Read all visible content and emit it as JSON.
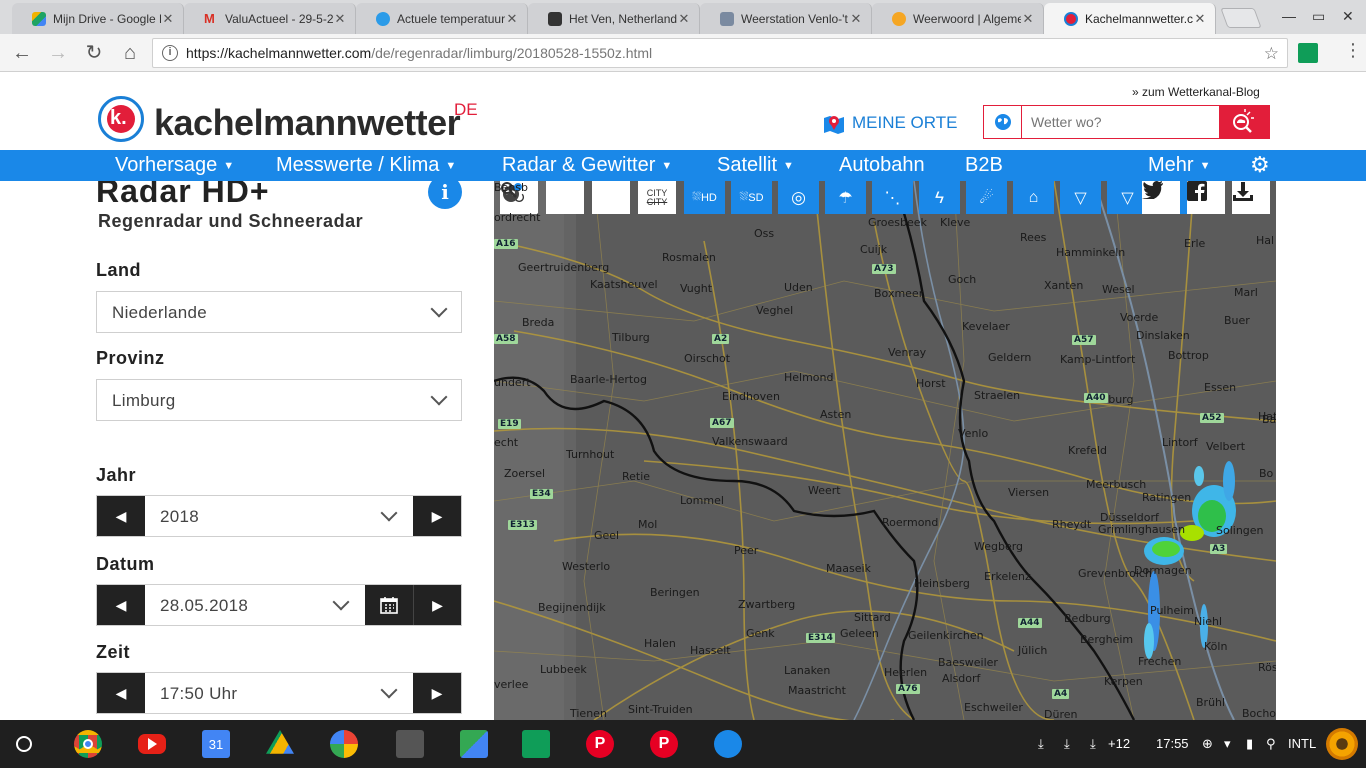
{
  "browser": {
    "tabs": [
      {
        "title": "Mijn Drive - Google D",
        "color": "#f2b300"
      },
      {
        "title": "ValuActueel - 29-5-2(",
        "color": "#d93025"
      },
      {
        "title": "Actuele temperatuur",
        "color": "#2b9be8"
      },
      {
        "title": "Het Ven, Netherlands",
        "color": "#333333"
      },
      {
        "title": "Weerstation Venlo-'t",
        "color": "#7a8aa0"
      },
      {
        "title": "Weerwoord | Algeme",
        "color": "#f5a623"
      },
      {
        "title": "Kachelmannwetter.c",
        "color": "#1a7fd6"
      }
    ],
    "url_host": "https://kachelmannwetter.com",
    "url_path": "/de/regenradar/limburg/20180528-1550z.html"
  },
  "site": {
    "logo_text": "kachelmannwetter",
    "logo_country": "DE",
    "logo_letter": "k.",
    "blog_link": "» zum Wetterkanal-Blog",
    "meine_orte": "MEINE ORTE",
    "search_placeholder": "Wetter wo?",
    "nav": {
      "vorhersage": "Vorhersage",
      "messwerte": "Messwerte / Klima",
      "radar": "Radar & Gewitter",
      "satellit": "Satellit",
      "autobahn": "Autobahn",
      "b2b": "B2B",
      "mehr": "Mehr"
    },
    "accent": "#1a88e8",
    "brand_red": "#e21e3a"
  },
  "panel": {
    "title": "Radar HD+",
    "subtitle": "Regenradar und Schneeradar",
    "land_label": "Land",
    "land_value": "Niederlande",
    "provinz_label": "Provinz",
    "provinz_value": "Limburg",
    "jahr_label": "Jahr",
    "jahr_value": "2018",
    "datum_label": "Datum",
    "datum_value": "28.05.2018",
    "zeit_label": "Zeit",
    "zeit_value": "17:50 Uhr"
  },
  "map": {
    "toolbar": {
      "city_label": "CITY",
      "hd_label": "HD",
      "sd_label": "SD"
    },
    "towns": [
      "ordrecht",
      "Geertruidenberg",
      "Kaatsheuvel",
      "Vught",
      "Rosmalen",
      "Oss",
      "Uden",
      "Veghel",
      "Groesbeek",
      "Kleve",
      "Cuijk",
      "Boxmeer",
      "Goch",
      "Rees",
      "Hamminkeln",
      "Xanten",
      "Wesel",
      "Erle",
      "Hal",
      "Marl",
      "Buer",
      "Breda",
      "Tilburg",
      "Oirschot",
      "Helmond",
      "Venray",
      "Kevelaer",
      "Geldern",
      "Kamp-Lintfort",
      "Voerde",
      "Dinslaken",
      "Bottrop",
      "undert",
      "Baarle-Hertog",
      "Eindhoven",
      "Horst",
      "Straelen",
      "Essen",
      "Duisburg",
      "Asten",
      "Venlo",
      "Krefeld",
      "Lintorf",
      "Velbert",
      "Hatti",
      "echt",
      "Turnhout",
      "Valkenswaard",
      "Retie",
      "Zoersel",
      "Lommel",
      "Weert",
      "Viersen",
      "Meerbusch",
      "Ratingen",
      "Düsseldorf",
      "Bo",
      "Ba",
      "Mol",
      "Geel",
      "Roermond",
      "Rheydt",
      "Grimlinghausen",
      "Solingen",
      "Peer",
      "Wegberg",
      "Westerlo",
      "Maaseik",
      "Heinsberg",
      "Erkelenz",
      "Grevenbroich",
      "Dormagen",
      "Beringen",
      "Zwartberg",
      "Begijnendijk",
      "Sittard",
      "Geleen",
      "Genk",
      "Geilenkirchen",
      "Bedburg",
      "Pulheim",
      "Niehl",
      "Bergheim",
      "Halen",
      "Hasselt",
      "Jülich",
      "Köln",
      "Frechen",
      "Lubbeek",
      "Baesweiler",
      "Alsdorf",
      "Lanaken",
      "Heerlen",
      "Kerpen",
      "Rös",
      "verlee",
      "Maastricht",
      "Brühl",
      "Tienen",
      "Sint-Truiden",
      "Eschweiler",
      "Düren",
      "Bocholt",
      "Bensb"
    ],
    "roads": [
      "A16",
      "A73",
      "A2",
      "A58",
      "A57",
      "A40",
      "A52",
      "A67",
      "E19",
      "E34",
      "E313",
      "E314",
      "A44",
      "A76",
      "A4",
      "A3"
    ]
  },
  "social": {
    "twitter": "twitter-icon",
    "facebook": "facebook-icon",
    "download": "download-icon"
  },
  "shelf": {
    "downloads_more": "+12",
    "time": "17:55",
    "ime": "INTL"
  }
}
